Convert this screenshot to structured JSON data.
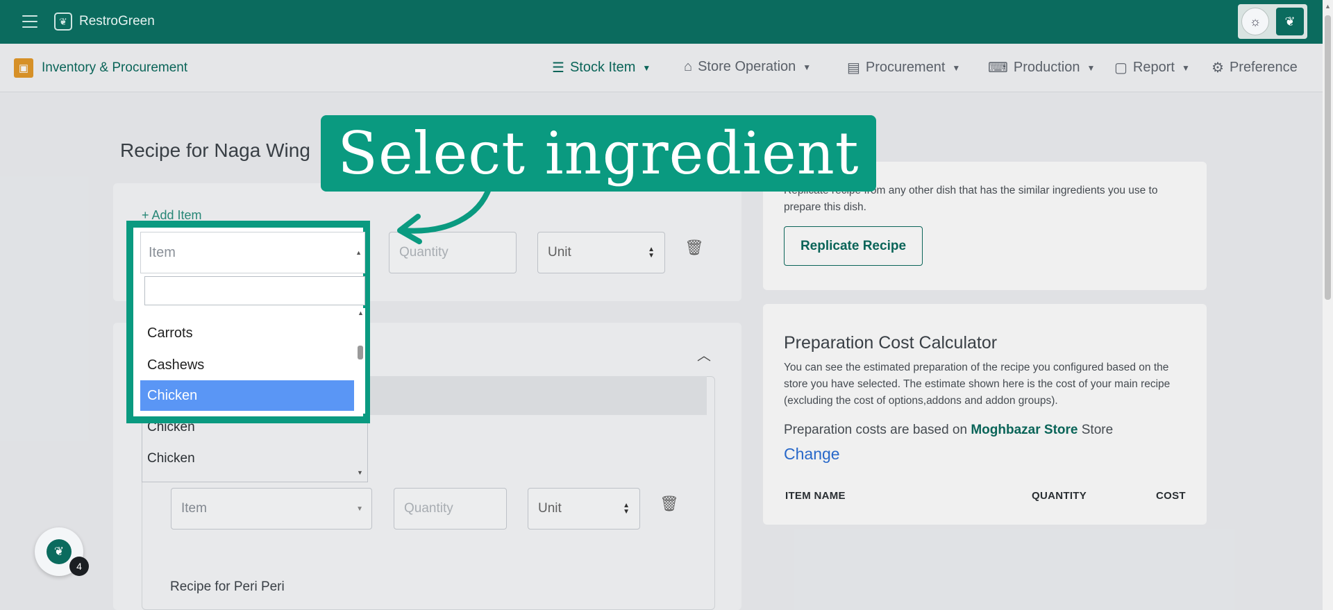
{
  "app": {
    "brand": "RestroGreen"
  },
  "module": {
    "title": "Inventory & Procurement"
  },
  "nav": {
    "stock_item": "Stock Item",
    "store_operation": "Store Operation",
    "procurement": "Procurement",
    "production": "Production",
    "report": "Report",
    "preference": "Preference"
  },
  "page": {
    "title": "Recipe for Naga Wing"
  },
  "recipe": {
    "add_item": "+ Add Item",
    "item_placeholder": "Item",
    "quantity_placeholder": "Quantity",
    "unit_label": "Unit",
    "sub_recipe_title": "Recipe for Peri Peri"
  },
  "dropdown": {
    "header": "Item",
    "options": [
      "Carrots",
      "Cashews",
      "Chicken"
    ],
    "selected": "Chicken",
    "below_options": [
      "Chicken",
      "Chicken"
    ]
  },
  "callout": {
    "text": "Select ingredient"
  },
  "replicate": {
    "description": "Replicate recipe from any other dish that has the similar ingredients you use to prepare this dish.",
    "button": "Replicate Recipe"
  },
  "calculator": {
    "title": "Preparation Cost Calculator",
    "description": "You can see the estimated preparation of the recipe you configured based on the store you have selected. The estimate shown here is the cost of your main recipe (excluding the cost of options,addons and addon groups).",
    "cost_prefix": "Preparation costs are based on",
    "store_name": "Moghbazar Store",
    "cost_suffix": "Store",
    "change_link": "Change",
    "columns": [
      "ITEM NAME",
      "QUANTITY",
      "COST"
    ]
  },
  "fab": {
    "badge": "4"
  }
}
